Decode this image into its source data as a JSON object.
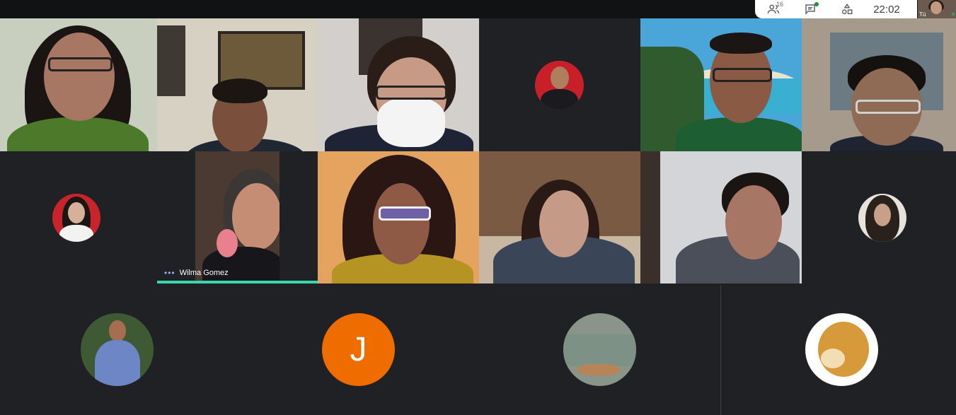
{
  "toolbar": {
    "participants_count": "16",
    "clock": "22:02",
    "self_label": "Tú"
  },
  "tiles": {
    "speaker_name": "Wilma Gomez"
  },
  "avatars": {
    "initial_j": "J"
  },
  "colors": {
    "background": "#202124",
    "speaking_accent": "#3ad6b0",
    "avatar_orange": "#ef6c00",
    "chat_dot": "#1e8e3e"
  }
}
